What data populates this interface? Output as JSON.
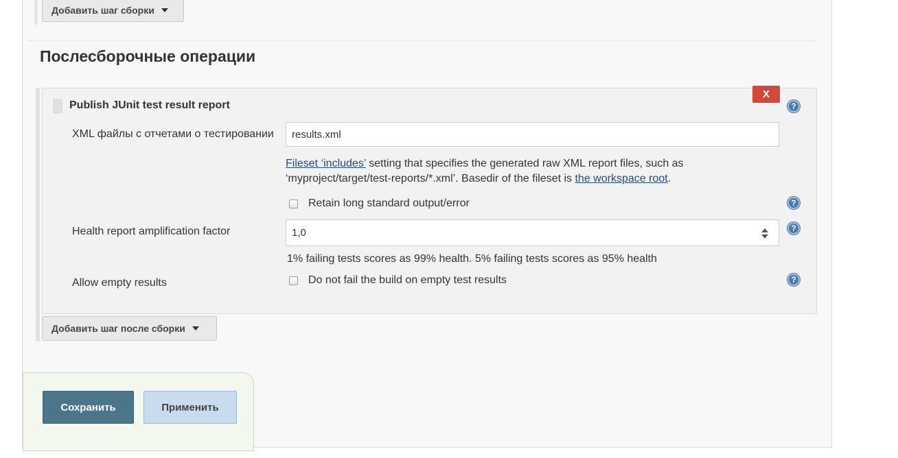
{
  "build": {
    "add_step_label": "Добавить шаг сборки"
  },
  "post_build": {
    "section_title": "Послесборочные операции",
    "add_step_label": "Добавить шаг после сборки"
  },
  "junit_step": {
    "title": "Publish JUnit test result report",
    "delete_label": "X",
    "xml_files_label": "XML файлы с отчетами о тестировании",
    "xml_files_value": "results.xml",
    "xml_help": {
      "link1": "Fileset ‘includes’",
      "text1": " setting that specifies the generated raw XML report files, such as",
      "text2": "‘myproject/target/test-reports/*.xml’. Basedir of the fileset is ",
      "link2": "the workspace root",
      "text3": "."
    },
    "retain_output_label": "Retain long standard output/error",
    "retain_output_checked": false,
    "health_factor_label": "Health report amplification factor",
    "health_factor_value": "1,0",
    "health_factor_desc": "1% failing tests scores as 99% health. 5% failing tests scores as 95% health",
    "allow_empty_label": "Allow empty results",
    "allow_empty_checkbox_label": "Do not fail the build on empty test results",
    "allow_empty_checked": false,
    "help_icon": "?"
  },
  "footer": {
    "save_label": "Сохранить",
    "apply_label": "Применить"
  },
  "colors": {
    "save_bg": "#4b758b",
    "apply_bg": "#c9dcef",
    "delete_bg": "#d24939",
    "link": "#204a87"
  },
  "icons": {
    "help": "help-icon",
    "caret": "caret-down-icon",
    "drag": "drag-handle-icon"
  }
}
